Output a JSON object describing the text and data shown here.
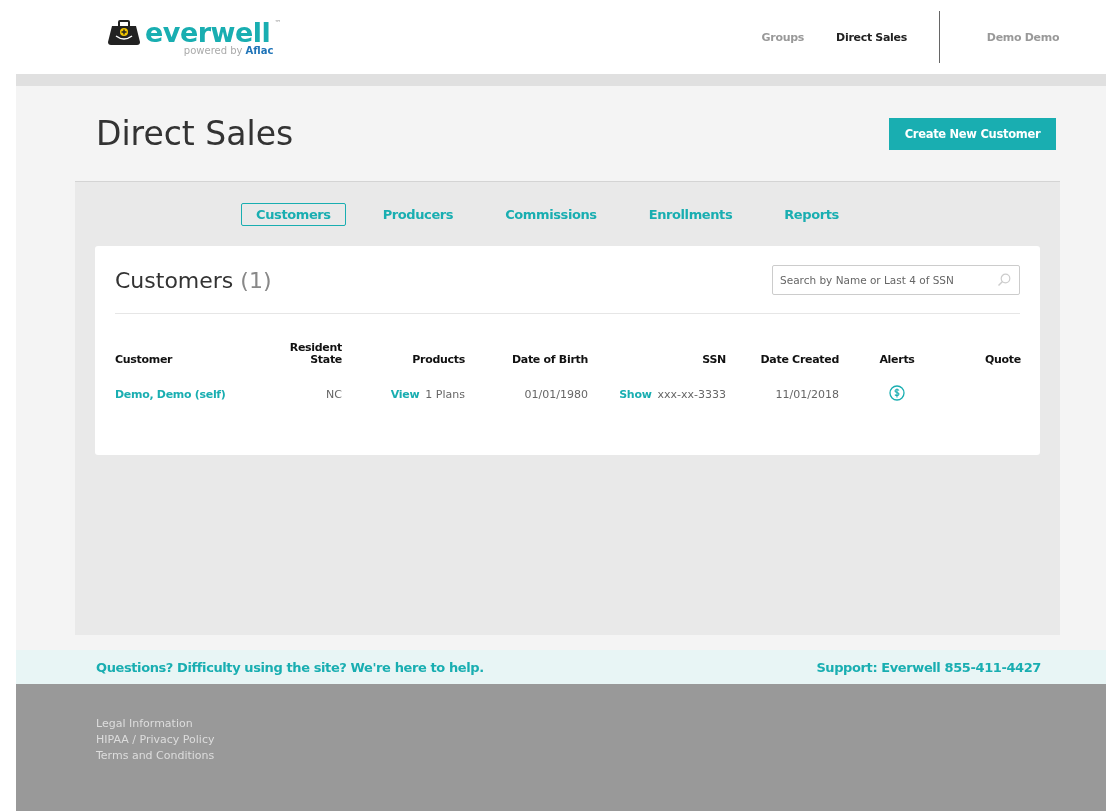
{
  "header": {
    "logo": {
      "name": "everwell",
      "trademark": "™",
      "powered_by": "powered by",
      "partner": "Aflac"
    },
    "nav": [
      {
        "label": "Groups",
        "selected": false
      },
      {
        "label": "Direct Sales",
        "selected": true
      }
    ],
    "user": "Demo Demo"
  },
  "page": {
    "title": "Direct Sales",
    "primary_button": "Create New Customer"
  },
  "tabs": [
    {
      "label": "Customers",
      "selected": true
    },
    {
      "label": "Producers",
      "selected": false
    },
    {
      "label": "Commissions",
      "selected": false
    },
    {
      "label": "Enrollments",
      "selected": false
    },
    {
      "label": "Reports",
      "selected": false
    }
  ],
  "customers": {
    "title": "Customers",
    "count": "(1)",
    "search": {
      "placeholder": "Search by Name or Last 4 of SSN"
    },
    "columns": [
      "Customer",
      "Resident State",
      "Products",
      "Date of Birth",
      "SSN",
      "Date Created",
      "Alerts",
      "Quote"
    ],
    "rows": [
      {
        "customer": "Demo, Demo (self)",
        "state": "NC",
        "products_link": "View",
        "products": "1 Plans",
        "dob": "01/01/1980",
        "ssn_link": "Show",
        "ssn": "xxx-xx-3333",
        "created": "11/01/2018",
        "alerts": [
          {
            "kind": "payment"
          }
        ]
      }
    ]
  },
  "help": {
    "text": "Questions? Difficulty using the site? We're here to help.",
    "support": "Support: Everwell 855-411-4427"
  },
  "footer_links": [
    "Legal Information",
    "HIPAA / Privacy Policy",
    "Terms and Conditions"
  ]
}
